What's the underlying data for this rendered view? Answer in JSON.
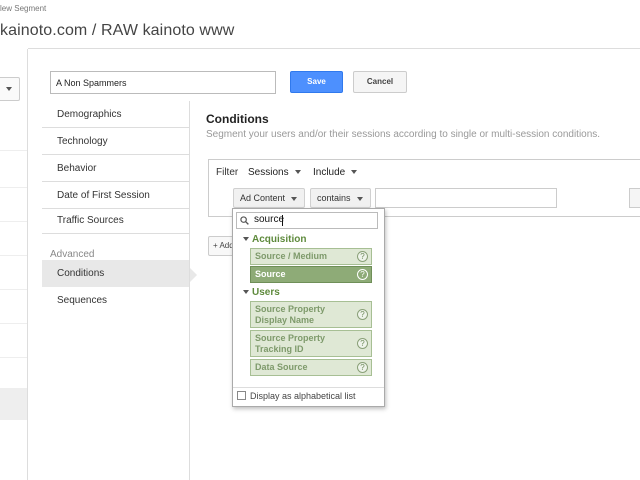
{
  "header": {
    "breadcrumb": "lew Segment",
    "title": "kainoto.com / RAW kainoto www"
  },
  "form": {
    "segment_name": "A Non Spammers",
    "save_label": "Save",
    "cancel_label": "Cancel"
  },
  "nav": {
    "items": [
      "Demographics",
      "Technology",
      "Behavior",
      "Date of First Session",
      "Traffic Sources"
    ],
    "advanced_heading": "Advanced",
    "advanced_items": [
      "Conditions",
      "Sequences"
    ],
    "active": "Conditions"
  },
  "conditions": {
    "title": "Conditions",
    "description": "Segment your users and/or their sessions according to single or multi-session conditions.",
    "filter_label": "Filter",
    "scope": "Sessions",
    "mode": "Include",
    "dimension": "Ad Content",
    "match_type": "contains",
    "value": "",
    "add_button_label": "+ Add"
  },
  "dropdown": {
    "search_value": "source",
    "groups": [
      {
        "name": "Acquisition",
        "options": [
          {
            "label": "Source / Medium"
          },
          {
            "label": "Source",
            "selected": true
          }
        ]
      },
      {
        "name": "Users",
        "options": [
          {
            "label": "Source Property Display Name"
          },
          {
            "label": "Source Property Tracking ID"
          },
          {
            "label": "Data Source"
          }
        ]
      }
    ],
    "alpha_label": "Display as alphabetical list",
    "alpha_checked": false
  },
  "colors": {
    "accent_blue": "#4d90fe",
    "option_green": "#dfe8d5",
    "selected_green": "#8eab77",
    "group_green": "#5e8a3c"
  }
}
